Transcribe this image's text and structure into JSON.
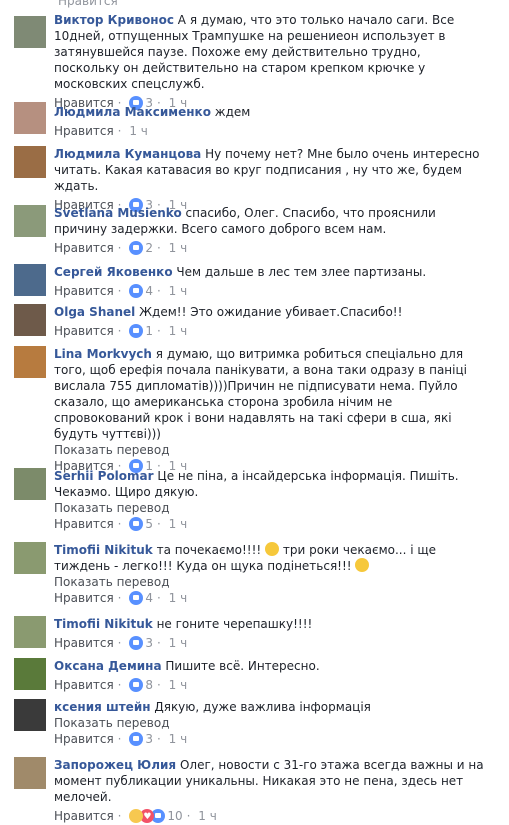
{
  "top_actions": "Нравится",
  "comments": [
    {
      "author": "Виктор Кривонос",
      "text": "А я думаю, что это только начало саги. Все 10дней, отпущенных Трампушке на решениеон использует в затянувшейся паузе. Похоже ему действительно трудно, поскольку он действительно на старом крепком крючке у московских спецслужб.",
      "like": "Нравится",
      "reply_count": "3",
      "time": "1 ч",
      "avatar_color": "#7f8a75"
    },
    {
      "author": "Людмила Максименко",
      "text": "ждем",
      "like": "Нравится",
      "time": "1 ч",
      "avatar_color": "#b69080"
    },
    {
      "author": "Людмила Куманцова",
      "text": "Ну почему нет? Мне было очень интересно читать. Какая катавасия во круг подписания , ну что же, будем ждать.",
      "like": "Нравится",
      "reply_count": "3",
      "time": "1 ч",
      "avatar_color": "#9a6d45"
    },
    {
      "author": "Svetlana Musienko",
      "text": "спасибо, Олег. Спасибо, что прояснили причину задержки. Всего самого доброго всем нам.",
      "like": "Нравится",
      "reply_count": "2",
      "time": "1 ч",
      "avatar_color": "#8b9a7a"
    },
    {
      "author": "Сергей Яковенко",
      "text": "Чем дальше в лес тем злее партизаны.",
      "like": "Нравится",
      "reply_count": "4",
      "time": "1 ч",
      "avatar_color": "#4d6a8c"
    },
    {
      "author": "Olga Shanel",
      "text": "Ждем!! Это ожидание убивает.Спасибо!!",
      "like": "Нравится",
      "reply_count": "1",
      "time": "1 ч",
      "avatar_color": "#6e5a4a"
    },
    {
      "author": "Lina Morkvych",
      "text": "я думаю, що витримка робиться спеціально для того, щоб ерефія почала панікувати, а вона таки одразу в паніці вислала 755 дипломатів))))Причин не підписувати нема. Пуйло сказало, що американська сторона зробила нічим не спровокований крок і вони надавлять на такі сфери в сша, які будуть чуттєві)))",
      "translate": "Показать перевод",
      "like": "Нравится",
      "reply_count": "1",
      "time": "1 ч",
      "avatar_color": "#b77b3f"
    },
    {
      "author": "Serhii Polomar",
      "text": "Це не піна, а інсайдерська інформація. Пишіть. Чекаэмо. Щиро дякую.",
      "translate": "Показать перевод",
      "like": "Нравится",
      "reply_count": "5",
      "time": "1 ч",
      "avatar_color": "#7c8b6a"
    },
    {
      "author": "Timofii Nikituk",
      "text_parts": [
        "та почекаємо!!!! ",
        "три роки чекаємо... і ще тиждень - легко!!! Куда он щука подінеться!!! "
      ],
      "translate": "Показать перевод",
      "like": "Нравится",
      "reply_count": "4",
      "time": "1 ч",
      "avatar_color": "#8a9a70"
    },
    {
      "author": "Timofii Nikituk",
      "text": "не гоните черепашку!!!!",
      "like": "Нравится",
      "reply_count": "3",
      "time": "1 ч",
      "avatar_color": "#8a9a70"
    },
    {
      "author": "Оксана Демина",
      "text": "Пишите всё. Интересно.",
      "like": "Нравится",
      "reply_count": "8",
      "time": "1 ч",
      "avatar_color": "#5a7a3a"
    },
    {
      "author": "ксения штейн",
      "text": "Дякую, дуже важлива інформація",
      "translate": "Показать перевод",
      "like": "Нравится",
      "reply_count": "3",
      "time": "1 ч",
      "avatar_color": "#3a3a3a"
    },
    {
      "author": "Запорожец Юлия",
      "text": "Олег, новости с 31-го этажа всегда важны и на момент публикации уникальны. Никакая это не пена, здесь нет мелочей.",
      "like": "Нравится",
      "reply_count": "10",
      "time": "1 ч",
      "avatar_color": "#a08a6a"
    }
  ],
  "colors": {
    "author": "#365899",
    "meta": "#90949c",
    "like_blue": "#5890ff",
    "love_red": "#f25268"
  }
}
